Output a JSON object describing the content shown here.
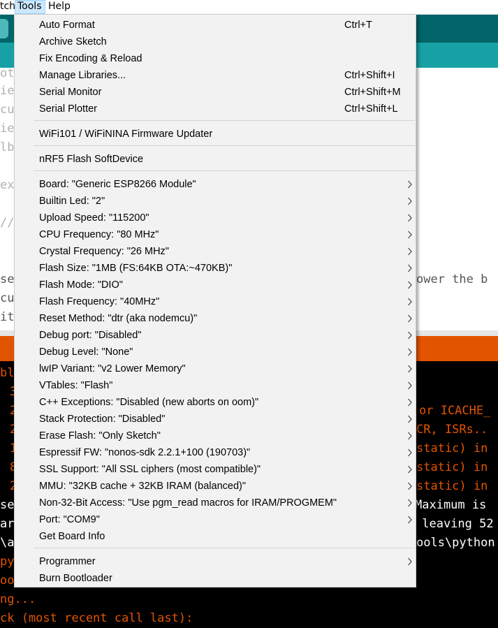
{
  "menubar": {
    "items": [
      {
        "label": "tch"
      },
      {
        "label": "Tools"
      },
      {
        "label": "Help"
      }
    ]
  },
  "editor": {
    "lines": [
      "ot",
      "ie",
      "cu",
      "ie",
      "lb",
      "ex",
      "//",
      "se",
      "cu",
      "it"
    ],
    "right_text": "ower the b"
  },
  "console": {
    "lines": [
      "ble",
      "3",
      "2",
      "2",
      "1",
      "8",
      "2",
      "se",
      "ar",
      "\\a",
      "py",
      "oo",
      "ng...",
      "ck (most recent call last):"
    ],
    "right_lines": [
      "or ICACHE_",
      "CR, ISRs..",
      "static) in",
      "static) in",
      "static) in",
      "Maximum is",
      " leaving 52",
      "ools\\python"
    ]
  },
  "tools_menu": {
    "items": [
      {
        "label": "Auto Format",
        "shortcut": "Ctrl+T"
      },
      {
        "label": "Archive Sketch",
        "shortcut": ""
      },
      {
        "label": "Fix Encoding & Reload",
        "shortcut": ""
      },
      {
        "label": "Manage Libraries...",
        "shortcut": "Ctrl+Shift+I"
      },
      {
        "label": "Serial Monitor",
        "shortcut": "Ctrl+Shift+M"
      },
      {
        "label": "Serial Plotter",
        "shortcut": "Ctrl+Shift+L"
      },
      {
        "label": "WiFi101 / WiFiNINA Firmware Updater",
        "shortcut": ""
      },
      {
        "label": "nRF5 Flash SoftDevice",
        "shortcut": ""
      },
      {
        "label": "Board: \"Generic ESP8266 Module\"",
        "submenu": true
      },
      {
        "label": "Builtin Led: \"2\"",
        "submenu": true
      },
      {
        "label": "Upload Speed: \"115200\"",
        "submenu": true
      },
      {
        "label": "CPU Frequency: \"80 MHz\"",
        "submenu": true
      },
      {
        "label": "Crystal Frequency: \"26 MHz\"",
        "submenu": true
      },
      {
        "label": "Flash Size: \"1MB (FS:64KB OTA:~470KB)\"",
        "submenu": true
      },
      {
        "label": "Flash Mode: \"DIO\"",
        "submenu": true
      },
      {
        "label": "Flash Frequency: \"40MHz\"",
        "submenu": true
      },
      {
        "label": "Reset Method: \"dtr (aka nodemcu)\"",
        "submenu": true
      },
      {
        "label": "Debug port: \"Disabled\"",
        "submenu": true
      },
      {
        "label": "Debug Level: \"None\"",
        "submenu": true
      },
      {
        "label": "lwIP Variant: \"v2 Lower Memory\"",
        "submenu": true
      },
      {
        "label": "VTables: \"Flash\"",
        "submenu": true
      },
      {
        "label": "C++ Exceptions: \"Disabled (new aborts on oom)\"",
        "submenu": true
      },
      {
        "label": "Stack Protection: \"Disabled\"",
        "submenu": true
      },
      {
        "label": "Erase Flash: \"Only Sketch\"",
        "submenu": true
      },
      {
        "label": "Espressif FW: \"nonos-sdk 2.2.1+100 (190703)\"",
        "submenu": true
      },
      {
        "label": "SSL Support: \"All SSL ciphers (most compatible)\"",
        "submenu": true
      },
      {
        "label": "MMU: \"32KB cache + 32KB IRAM (balanced)\"",
        "submenu": true
      },
      {
        "label": "Non-32-Bit Access: \"Use pgm_read macros for IRAM/PROGMEM\"",
        "submenu": true
      },
      {
        "label": "Port: \"COM9\"",
        "submenu": true
      },
      {
        "label": "Get Board Info",
        "submenu": false
      },
      {
        "label": "Programmer",
        "submenu": true
      },
      {
        "label": "Burn Bootloader",
        "submenu": false
      }
    ],
    "icons": {
      "submenu_arrow": "chevron-right-icon"
    }
  },
  "colors": {
    "toolbar": "#006468",
    "tabbar": "#17a1a5",
    "status": "#e35400",
    "console_bg": "#000000",
    "menu_bg": "#f2f2f2",
    "menubar_active": "#cce8ff"
  }
}
